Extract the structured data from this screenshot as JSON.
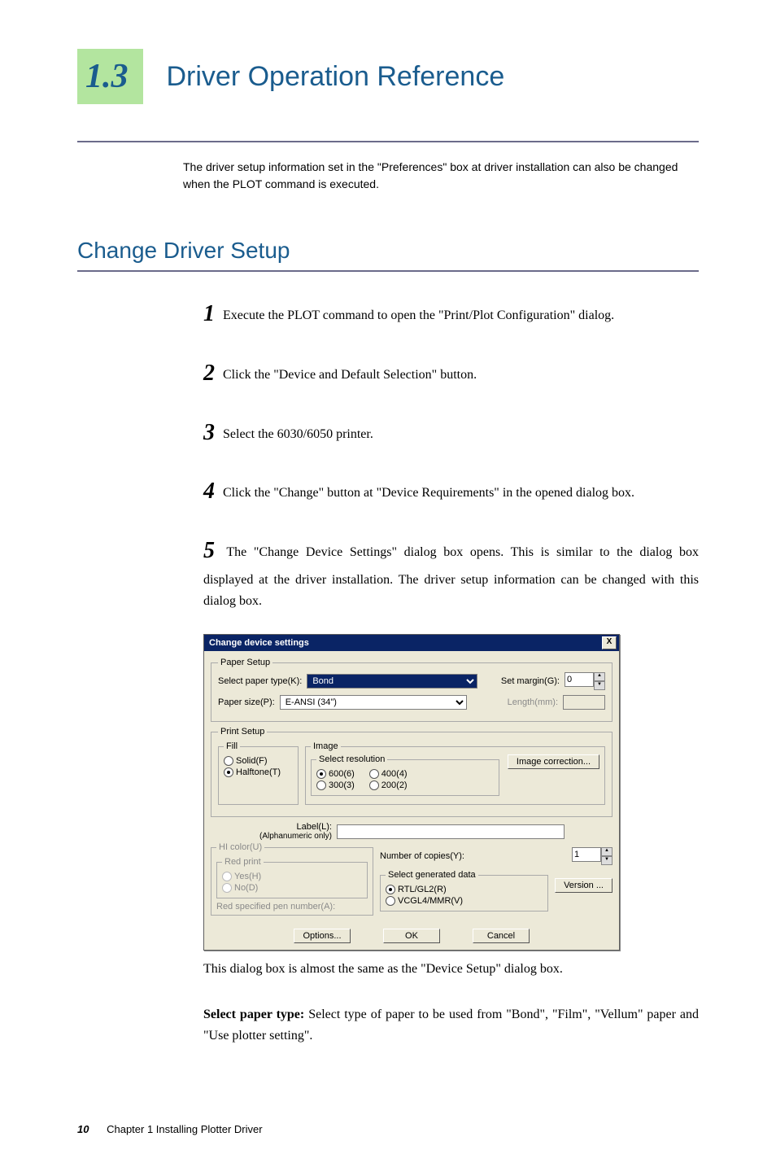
{
  "section": {
    "number": "1.3",
    "title": "Driver Operation Reference"
  },
  "intro": "The driver setup information set in the \"Preferences\" box at driver installation can also be changed when the PLOT command is executed.",
  "h2": "Change Driver Setup",
  "steps": {
    "s1": "Execute the PLOT command to open the \"Print/Plot Configuration\" dialog.",
    "s2": "Click the \"Device and Default Selection\" button.",
    "s3": "Select the 6030/6050 printer.",
    "s4": "Click the \"Change\" button at \"Device Requirements\" in the opened dialog box.",
    "s5": "The \"Change Device Settings\" dialog box opens. This is similar to the dialog box displayed at the driver installation. The driver setup information can be changed with this dialog box."
  },
  "dialog": {
    "title": "Change device settings",
    "close": "X",
    "paper_setup": {
      "legend": "Paper Setup",
      "select_paper_type_lbl": "Select paper type(K):",
      "select_paper_type_val": "Bond",
      "set_margin_lbl": "Set margin(G):",
      "set_margin_val": "0",
      "paper_size_lbl": "Paper size(P):",
      "paper_size_val": "E-ANSI (34\")",
      "length_lbl": "Length(mm):"
    },
    "print_setup": {
      "legend": "Print Setup",
      "fill": {
        "legend": "Fill",
        "solid": "Solid(F)",
        "halftone": "Halftone(T)"
      },
      "image": {
        "legend": "Image",
        "resolution_legend": "Select resolution",
        "r600": "600(6)",
        "r400": "400(4)",
        "r300": "300(3)",
        "r200": "200(2)",
        "btn_correction": "Image correction..."
      }
    },
    "label_lbl": "Label(L):",
    "label_hint": "(Alphanumeric only)",
    "hicolor": {
      "legend": "HI color(U)"
    },
    "redprint": {
      "legend": "Red print",
      "yes": "Yes(H)",
      "no": "No(D)"
    },
    "red_pen_lbl": "Red specified pen number(A):",
    "copies_lbl": "Number of copies(Y):",
    "copies_val": "1",
    "gendata": {
      "legend": "Select generated data",
      "rtl": "RTL/GL2(R)",
      "vcgl": "VCGL4/MMR(V)"
    },
    "btn_version": "Version ...",
    "btn_options": "Options...",
    "btn_ok": "OK",
    "btn_cancel": "Cancel"
  },
  "caption": "This dialog box is almost the same as the \"Device Setup\" dialog box.",
  "desc_bold": "Select paper type:",
  "desc_rest": " Select type of paper to be used from \"Bond\", \"Film\", \"Vellum\" paper and \"Use plotter setting\".",
  "footer": {
    "page": "10",
    "chapter": "Chapter 1  Installing Plotter Driver"
  },
  "nums": {
    "n1": "1",
    "n2": "2",
    "n3": "3",
    "n4": "4",
    "n5": "5"
  }
}
